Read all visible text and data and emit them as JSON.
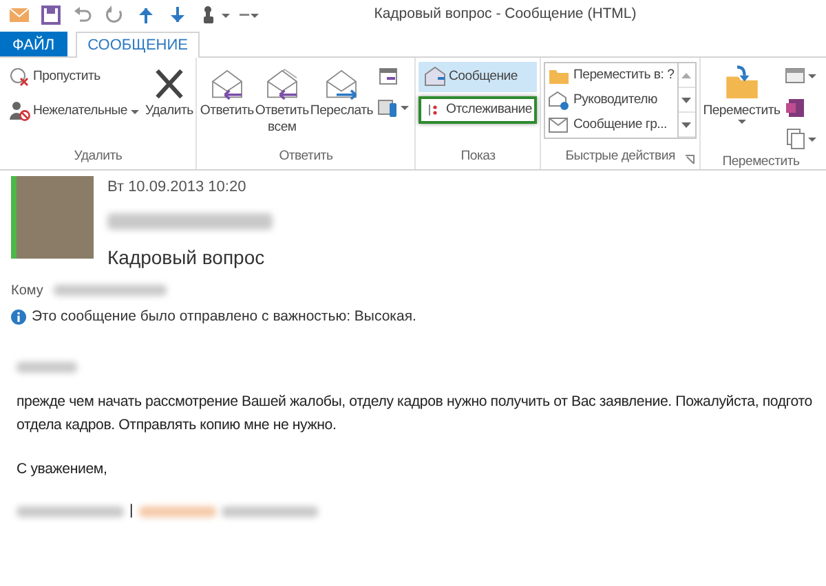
{
  "window": {
    "title": "Кадровый вопрос - Сообщение (HTML)"
  },
  "quick_access": [
    {
      "dropdown": false
    },
    {
      "dropdown": false
    },
    {
      "dropdown": false
    },
    {
      "dropdown": false
    },
    {
      "dropdown": false
    },
    {
      "dropdown": false
    },
    {
      "dropdown": true
    },
    {
      "dropdown": true
    }
  ],
  "tabs": [
    {
      "label": "ФАЙЛ",
      "kind": "file",
      "selected": false
    },
    {
      "label": "СООБЩЕНИЕ",
      "kind": "tab",
      "selected": true
    }
  ],
  "ribbon": [
    {
      "label": "Удалить",
      "launcher": false,
      "columns": [
        [
          {
            "kind": "small",
            "label": "Пропустить",
            "dropdown": false
          },
          {
            "kind": "small",
            "label": "Нежелательные",
            "dropdown": true
          }
        ],
        [
          {
            "kind": "large",
            "label": "Удалить",
            "dropdown": false
          }
        ]
      ]
    },
    {
      "label": "Ответить",
      "launcher": false,
      "columns": [
        [
          {
            "kind": "large",
            "label": "Ответить",
            "dropdown": false
          }
        ],
        [
          {
            "kind": "large",
            "label": "Ответить\nвсем",
            "dropdown": false
          }
        ],
        [
          {
            "kind": "large",
            "label": "Переслать",
            "dropdown": false
          }
        ],
        [
          {
            "kind": "icon",
            "dropdown": false
          },
          {
            "kind": "icon",
            "dropdown": true
          }
        ]
      ]
    },
    {
      "label": "Показ",
      "launcher": false,
      "columns": [
        [
          {
            "kind": "small",
            "label": "Сообщение",
            "dropdown": false,
            "selected": true,
            "highlighted": false
          },
          {
            "kind": "small",
            "label": "Отслеживание",
            "dropdown": false,
            "selected": false,
            "highlighted": true
          }
        ]
      ]
    },
    {
      "label": "Быстрые действия",
      "launcher": true,
      "columns": [
        [
          {
            "kind": "gallery",
            "items": [
              {
                "label": "Переместить в: ?"
              },
              {
                "label": "Руководителю"
              },
              {
                "label": "Сообщение гр..."
              }
            ]
          }
        ]
      ]
    },
    {
      "label": "Переместить",
      "launcher": false,
      "columns": [
        [
          {
            "kind": "large",
            "label": "Переместить",
            "dropdown": true
          }
        ],
        [
          {
            "kind": "icon",
            "dropdown": true
          },
          {
            "kind": "icon",
            "dropdown": false
          },
          {
            "kind": "icon",
            "dropdown": true
          }
        ]
      ]
    }
  ],
  "message": {
    "date": "Вт 10.09.2013 10:20",
    "subject": "Кадровый вопрос",
    "to_label": "Кому",
    "info": "Это сообщение было отправлено с важностью: Высокая.",
    "body": [
      "прежде чем начать рассмотрение Вашей жалобы, отделу кадров нужно получить от Вас заявление. Пожалуйста, подгото",
      "отдела кадров. Отправлять копию мне не нужно."
    ],
    "closing": "С уважением,",
    "signature_separator": "|"
  }
}
